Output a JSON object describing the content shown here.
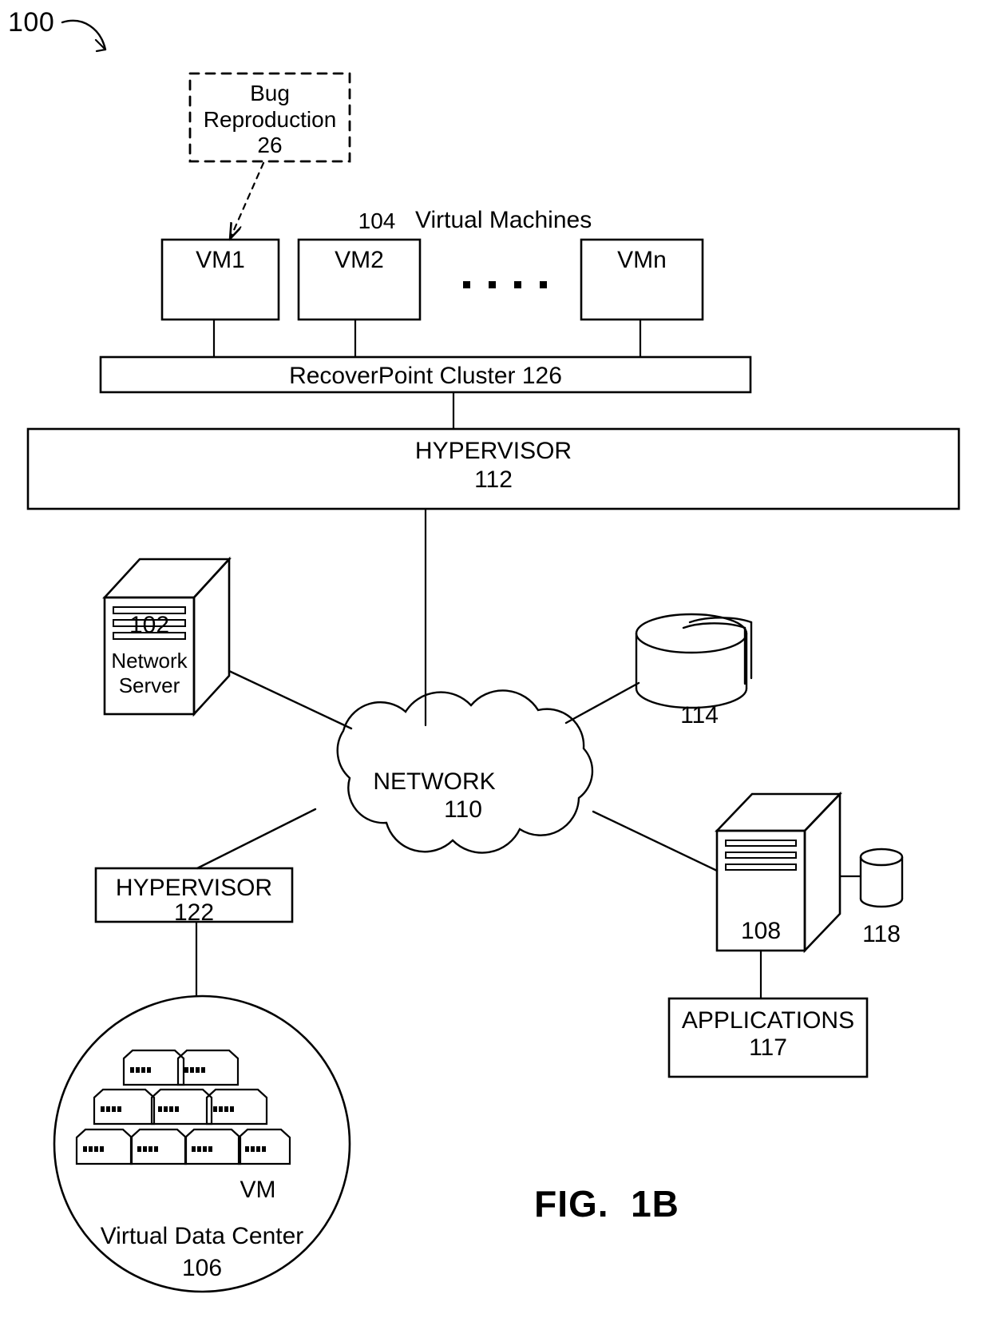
{
  "figure": {
    "ref_number": "100",
    "caption": "FIG.  1B"
  },
  "nodes": {
    "bug_reproduction": {
      "title": "Bug\nReproduction",
      "ref": "26",
      "style": "dashed-box"
    },
    "vm_group_label": {
      "ref": "104",
      "label": "Virtual Machines"
    },
    "vm1": {
      "label": "VM1"
    },
    "vm2": {
      "label": "VM2"
    },
    "vm_ellipsis": {
      "label": ". . . ."
    },
    "vmn": {
      "label": "VMn"
    },
    "recoverpoint_cluster": {
      "label": "RecoverPoint Cluster 126"
    },
    "hypervisor_top": {
      "title": "HYPERVISOR",
      "ref": "112"
    },
    "network_server": {
      "ref": "102",
      "title": "Network\nServer"
    },
    "network_cloud": {
      "title": "NETWORK",
      "ref": "110"
    },
    "storage_array": {
      "ref": "114"
    },
    "server_108": {
      "ref": "108"
    },
    "database_118": {
      "ref": "118"
    },
    "applications": {
      "title": "APPLICATIONS",
      "ref": "117"
    },
    "hypervisor_bottom": {
      "title": "HYPERVISOR",
      "ref": "122"
    },
    "virtual_data_center": {
      "title": "Virtual Data Center",
      "ref": "106",
      "vm_label": "VM",
      "vm_icon_count": 9
    }
  },
  "colors": {
    "stroke": "#000000",
    "background": "#ffffff"
  }
}
